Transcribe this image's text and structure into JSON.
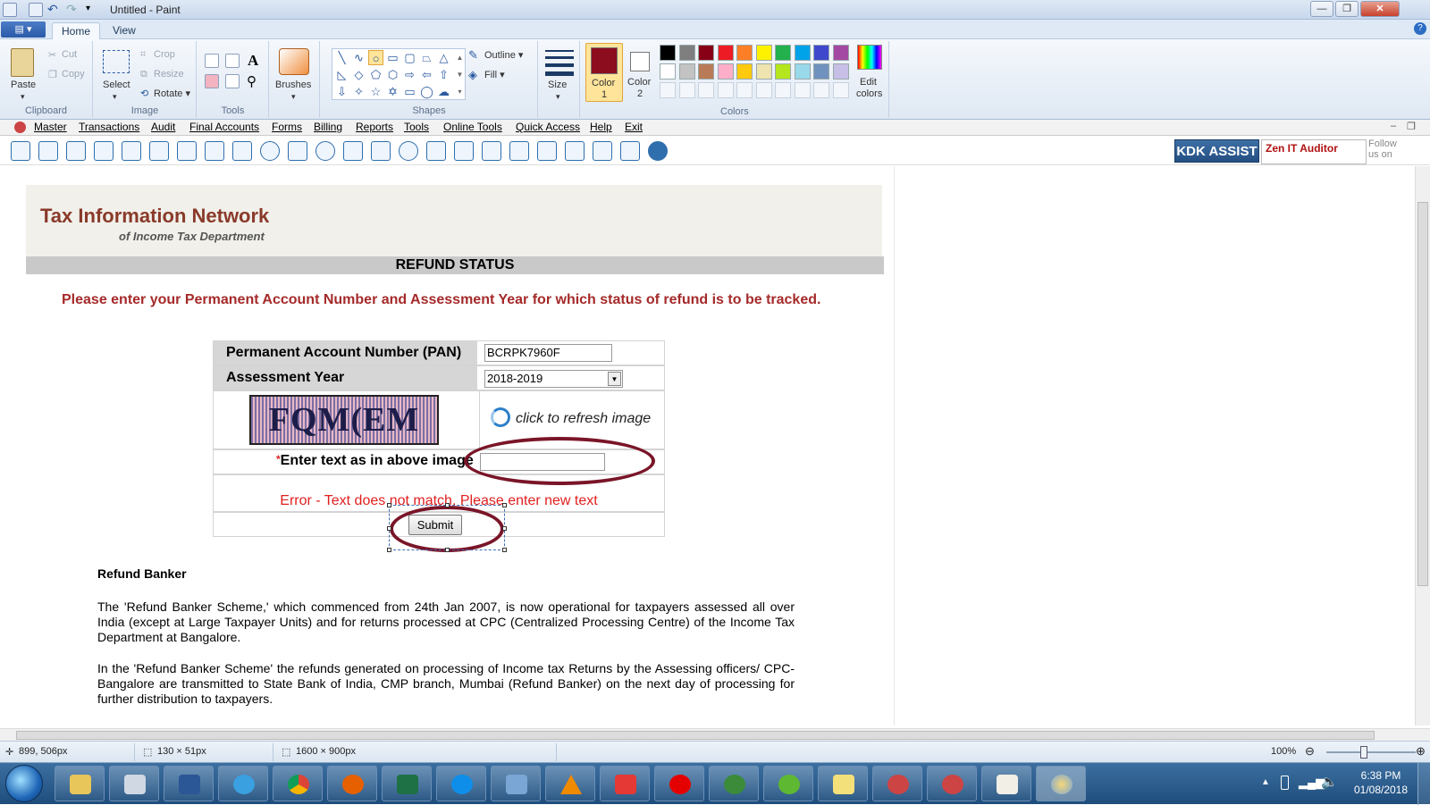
{
  "window": {
    "title": "Untitled - Paint",
    "min": "—",
    "max": "❐",
    "close": "✕"
  },
  "ribbon_tabs": {
    "file_btn": "▤ ▾",
    "home": "Home",
    "view": "View"
  },
  "ribbon": {
    "clipboard": {
      "paste": "Paste",
      "cut": "Cut",
      "copy": "Copy",
      "label": "Clipboard"
    },
    "image": {
      "select": "Select",
      "crop": "Crop",
      "resize": "Resize",
      "rotate": "Rotate ▾",
      "label": "Image"
    },
    "tools": {
      "label": "Tools",
      "text_tool": "A"
    },
    "brushes": {
      "label": "Brushes"
    },
    "shapes": {
      "outline": "Outline ▾",
      "fill": "Fill ▾",
      "label": "Shapes"
    },
    "size": {
      "label": "Size"
    },
    "color1": {
      "label": "Color",
      "num": "1",
      "value": "#8b0d1e"
    },
    "color2": {
      "label": "Color",
      "num": "2",
      "value": "#ffffff"
    },
    "edit_colors": {
      "label1": "Edit",
      "label2": "colors"
    },
    "colors_label": "Colors",
    "palette_row1": [
      "#000000",
      "#7f7f7f",
      "#880015",
      "#ed1c24",
      "#ff7f27",
      "#fff200",
      "#22b14c",
      "#00a2e8",
      "#3f48cc",
      "#a349a4"
    ],
    "palette_row2": [
      "#ffffff",
      "#c3c3c3",
      "#b97a57",
      "#ffaec9",
      "#ffc90e",
      "#efe4b0",
      "#b5e61d",
      "#99d9ea",
      "#7092be",
      "#c8bfe7"
    ]
  },
  "menubar": {
    "items": [
      "Master",
      "Transactions",
      "Audit",
      "Final Accounts",
      "Forms",
      "Billing",
      "Reports",
      "Tools",
      "Online Tools",
      "Quick Access",
      "Help",
      "Exit"
    ]
  },
  "toolbar": {
    "kdk": "KDK ASSIST",
    "zen": "Zen IT Auditor",
    "follow": "Follow us on"
  },
  "page": {
    "tin_title": "Tax Information Network",
    "tin_sub": "of Income Tax Department",
    "refund_bar": "REFUND STATUS",
    "instruction": "Please enter your Permanent Account Number and Assessment Year for which status of refund is to be tracked.",
    "pan_label": "Permanent Account Number (PAN)",
    "pan_value": "BCRPK7960F",
    "ay_label": "Assessment Year",
    "ay_value": "2018-2019",
    "captcha_text": "FQM(EM",
    "refresh_text": "click to refresh image",
    "captcha_label_star": "*",
    "captcha_label": "Enter text as in above image",
    "captcha_input": "",
    "error": "Error - Text does not match. Please enter new text",
    "submit": "Submit",
    "refund_banker_heading": "Refund Banker",
    "para1": "The 'Refund Banker Scheme,' which commenced from 24th Jan 2007, is now operational for taxpayers assessed all over India (except at Large Taxpayer Units) and for returns processed at CPC (Centralized Processing Centre) of the Income Tax Department at Bangalore.",
    "para2": "In the 'Refund Banker Scheme' the refunds generated on processing of Income tax Returns by the Assessing officers/ CPC-Bangalore are transmitted to State Bank of India, CMP branch, Mumbai (Refund Banker) on the next day of processing for further distribution to taxpayers."
  },
  "statusbar": {
    "cursor": "899, 506px",
    "selection": "130 × 51px",
    "canvas_size": "1600 × 900px",
    "zoom": "100%"
  },
  "taskbar": {
    "time": "6:38 PM",
    "date": "01/08/2018"
  }
}
